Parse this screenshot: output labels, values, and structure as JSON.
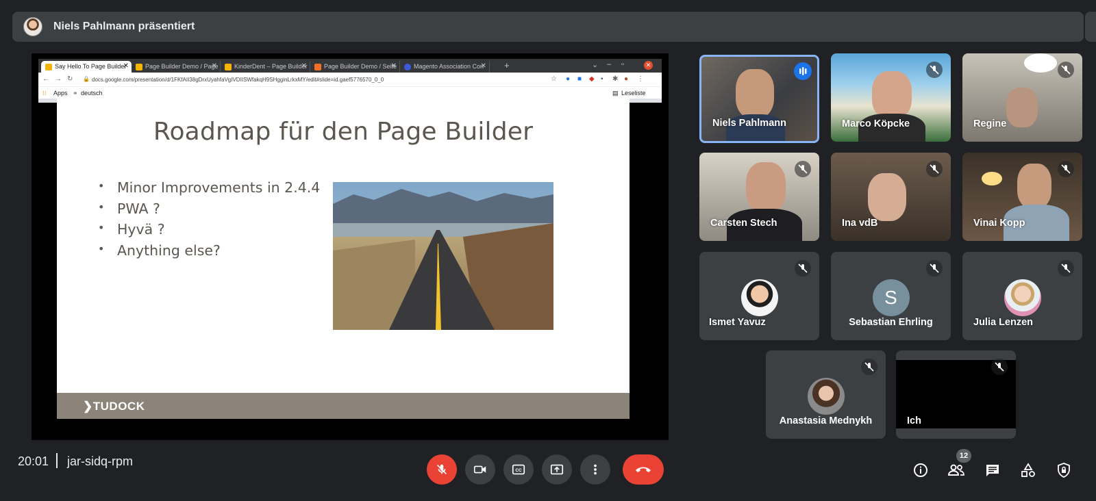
{
  "presenting": {
    "text": "Niels Pahlmann präsentiert"
  },
  "browser": {
    "tabs": [
      {
        "label": "Say Hello To Page Builder",
        "favicon_color": "#f4b400"
      },
      {
        "label": "Page Builder Demo / Page",
        "favicon_color": "#f4b400"
      },
      {
        "label": "KinderDent – Page Builder",
        "favicon_color": "#f4b400"
      },
      {
        "label": "Page Builder Demo / Seite",
        "favicon_color": "#f46f25"
      },
      {
        "label": "Magento Association Con",
        "favicon_color": "#3b5bdb"
      }
    ],
    "url": "docs.google.com/presentation/d/1FKfAII38gDrxUyahfaVgIVDIISWfakqH9SHgginLrkxMY/edit#slide=id.gaef5776570_0_0",
    "bookmarks": {
      "apps": "Apps",
      "deutsch": "deutsch",
      "reading_list": "Leseliste"
    }
  },
  "slide": {
    "title": "Roadmap für den Page Builder",
    "bullets": [
      "Minor Improvements in 2.4.4",
      "PWA ?",
      "Hyvä ?",
      "Anything else?"
    ],
    "logo": "TUDOCK"
  },
  "participants": [
    {
      "name": "Niels Pahlmann",
      "speaking": true
    },
    {
      "name": "Marco Köpcke"
    },
    {
      "name": "Regine"
    },
    {
      "name": "Carsten Stech"
    },
    {
      "name": "Ina vdB"
    },
    {
      "name": "Vinai Kopp"
    },
    {
      "name": "Ismet Yavuz"
    },
    {
      "name": "Sebastian Ehrling",
      "initial": "S"
    },
    {
      "name": "Julia Lenzen"
    },
    {
      "name": "Anastasia Mednykh"
    },
    {
      "name": "Ich"
    }
  ],
  "footer": {
    "time": "20:01",
    "meeting_code": "jar-sidq-rpm",
    "participant_count": "12"
  },
  "colors": {
    "hangup": "#ea4335",
    "accent": "#8ab4f8",
    "bg": "#202124"
  }
}
